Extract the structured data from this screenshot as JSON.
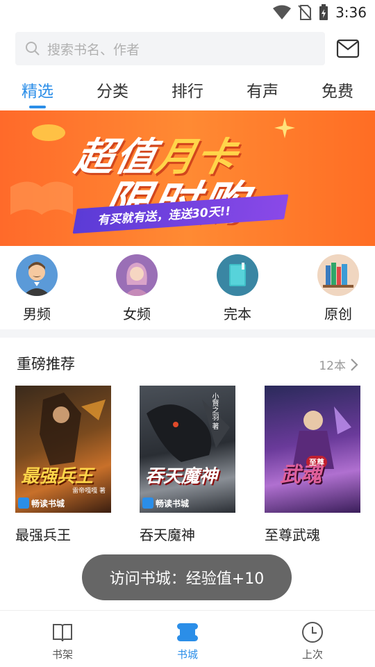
{
  "status_bar": {
    "time": "3:36"
  },
  "search": {
    "placeholder": "搜索书名、作者"
  },
  "tabs": [
    {
      "label": "精选",
      "active": true
    },
    {
      "label": "分类",
      "active": false
    },
    {
      "label": "排行",
      "active": false
    },
    {
      "label": "有声",
      "active": false
    },
    {
      "label": "免费",
      "active": false
    }
  ],
  "banner": {
    "line1_a": "超值",
    "line1_b": "月卡",
    "line2": "限时购",
    "ribbon": "有买就有送，连送30天!!"
  },
  "categories": [
    {
      "label": "男频",
      "icon": "male-avatar-icon"
    },
    {
      "label": "女频",
      "icon": "female-avatar-icon"
    },
    {
      "label": "完本",
      "icon": "book-icon"
    },
    {
      "label": "原创",
      "icon": "bookshelf-icon"
    }
  ],
  "recommend": {
    "title": "重磅推荐",
    "count": "12本",
    "books": [
      {
        "name": "最强兵王",
        "cover_title": "最强兵王",
        "cover_author": "雷帝嘎嘎 著",
        "brand": "畅读书城"
      },
      {
        "name": "吞天魔神",
        "cover_title": "吞天魔神",
        "cover_author": "小賢之羽 著",
        "brand": "畅读书城"
      },
      {
        "name": "至尊武魂",
        "cover_title": "武魂",
        "cover_subtitle": "至尊",
        "brand": ""
      }
    ]
  },
  "toast": {
    "text": "访问书城：经验值+10"
  },
  "bottom_nav": [
    {
      "label": "书架",
      "icon": "open-book-icon",
      "active": false
    },
    {
      "label": "书城",
      "icon": "store-icon",
      "active": true
    },
    {
      "label": "上次",
      "icon": "clock-icon",
      "active": false
    }
  ],
  "colors": {
    "accent": "#2b8ee8",
    "banner": "#ff7a2e"
  }
}
